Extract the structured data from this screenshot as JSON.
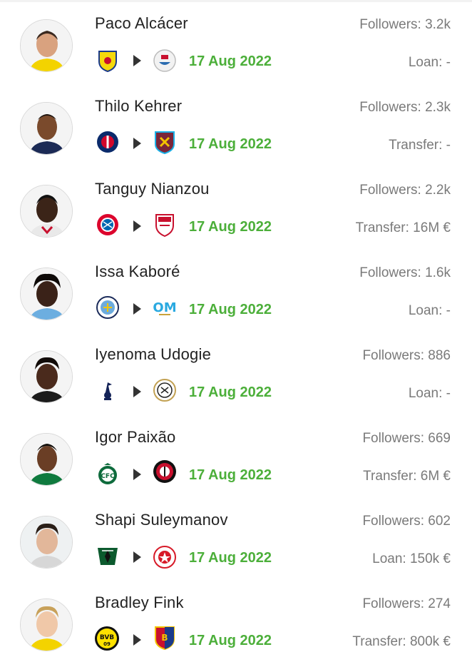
{
  "colors": {
    "date_green": "#4caf3a",
    "muted_text": "#7a7a7a",
    "name_text": "#222222"
  },
  "transfers": [
    {
      "player": "Paco Alcácer",
      "followers": "Followers: 3.2k",
      "from_club_icon": "villarreal-crest-icon",
      "to_club_icon": "sharjah-crest-icon",
      "date": "17 Aug 2022",
      "fee": "Loan: -"
    },
    {
      "player": "Thilo Kehrer",
      "followers": "Followers: 2.3k",
      "from_club_icon": "psg-crest-icon",
      "to_club_icon": "west-ham-crest-icon",
      "date": "17 Aug 2022",
      "fee": "Transfer: -"
    },
    {
      "player": "Tanguy Nianzou",
      "followers": "Followers: 2.2k",
      "from_club_icon": "bayern-crest-icon",
      "to_club_icon": "sevilla-crest-icon",
      "date": "17 Aug 2022",
      "fee": "Transfer: 16M €"
    },
    {
      "player": "Issa Kaboré",
      "followers": "Followers: 1.6k",
      "from_club_icon": "man-city-crest-icon",
      "to_club_icon": "marseille-crest-icon",
      "date": "17 Aug 2022",
      "fee": "Loan: -"
    },
    {
      "player": "Iyenoma Udogie",
      "followers": "Followers: 886",
      "from_club_icon": "tottenham-crest-icon",
      "to_club_icon": "udinese-crest-icon",
      "date": "17 Aug 2022",
      "fee": "Loan: -"
    },
    {
      "player": "Igor Paixão",
      "followers": "Followers: 669",
      "from_club_icon": "coritiba-crest-icon",
      "to_club_icon": "feyenoord-crest-icon",
      "date": "17 Aug 2022",
      "fee": "Transfer: 6M €"
    },
    {
      "player": "Shapi Suleymanov",
      "followers": "Followers: 602",
      "from_club_icon": "krasnodar-crest-icon",
      "to_club_icon": "hapoel-crest-icon",
      "date": "17 Aug 2022",
      "fee": "Loan: 150k €"
    },
    {
      "player": "Bradley Fink",
      "followers": "Followers: 274",
      "from_club_icon": "dortmund-crest-icon",
      "to_club_icon": "basel-crest-icon",
      "date": "17 Aug 2022",
      "fee": "Transfer: 800k €"
    }
  ]
}
